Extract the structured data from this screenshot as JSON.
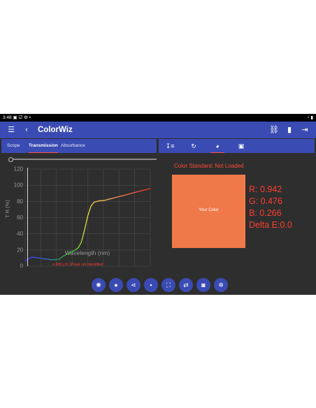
{
  "status_bar": {
    "time": "3:48",
    "left_icons": "▣ ☑ ⚙ •",
    "right_icons": "◔ ▮"
  },
  "app_bar": {
    "title": "ColorWiz",
    "menu_icon": "menu-icon",
    "back_icon": "back-icon",
    "link_icon": "link-icon",
    "device_icon": "device-icon",
    "exit_icon": "exit-icon"
  },
  "tabs": [
    {
      "label": "Scope",
      "active": false
    },
    {
      "label": "Transmission",
      "active": true
    },
    {
      "label": "Absorbance",
      "active": false
    }
  ],
  "right_tabs": [
    {
      "icon": "sort-icon",
      "glyph": "↧≡",
      "active": false
    },
    {
      "icon": "refresh-icon",
      "glyph": "↻",
      "active": false
    },
    {
      "icon": "palette-icon",
      "glyph": "◕",
      "active": true
    },
    {
      "icon": "gallery-icon",
      "glyph": "▣",
      "active": false
    }
  ],
  "chart_data": {
    "type": "line",
    "ylabel": "T R (%)",
    "xlabel": "Wavelength (nm)",
    "xlim": [
      380,
      780
    ],
    "ylim": [
      0,
      120
    ],
    "xticks": [
      380,
      480,
      580,
      680,
      780
    ],
    "yticks": [
      0,
      20,
      40,
      60,
      80,
      100,
      120
    ],
    "grid": true,
    "marker_x": 388,
    "x": [
      380,
      390,
      400,
      410,
      420,
      430,
      440,
      450,
      460,
      470,
      480,
      490,
      500,
      510,
      520,
      530,
      540,
      550,
      560,
      570,
      580,
      590,
      600,
      610,
      620,
      630,
      640,
      650,
      660,
      670,
      680,
      690,
      700,
      710,
      720,
      730,
      740,
      750,
      760,
      770,
      780
    ],
    "y": [
      6,
      9,
      11,
      11,
      10,
      10,
      9,
      9,
      8,
      8,
      8,
      9,
      12,
      14,
      16,
      18,
      20,
      23,
      30,
      45,
      62,
      74,
      79,
      80,
      81,
      81,
      82,
      83,
      84,
      85,
      86,
      87,
      88,
      89,
      90,
      91,
      92,
      93,
      94,
      95,
      96
    ],
    "status_text": "x:380,y:6.1Peak not Identified"
  },
  "color_panel": {
    "standard": "Color Standard: Not Loaded",
    "swatch_label": "Your Color",
    "swatch_color": "#f0794a",
    "r": "R: 0.942",
    "g": "G: 0.476",
    "b": "B: 0.266",
    "delta": "Delta E:0.0"
  },
  "fab_buttons": [
    {
      "icon": "light-icon",
      "glyph": "✺"
    },
    {
      "icon": "location-icon",
      "glyph": "●"
    },
    {
      "icon": "share-icon",
      "glyph": "⋖"
    },
    {
      "icon": "save-icon",
      "glyph": "▪"
    },
    {
      "icon": "fullscreen-icon",
      "glyph": "⛶"
    },
    {
      "icon": "swap-icon",
      "glyph": "⇄"
    },
    {
      "icon": "camera-icon",
      "glyph": "◙"
    },
    {
      "icon": "settings-icon",
      "glyph": "✲"
    }
  ],
  "accent": "#3a4bb3",
  "alert_color": "#ff3d30"
}
